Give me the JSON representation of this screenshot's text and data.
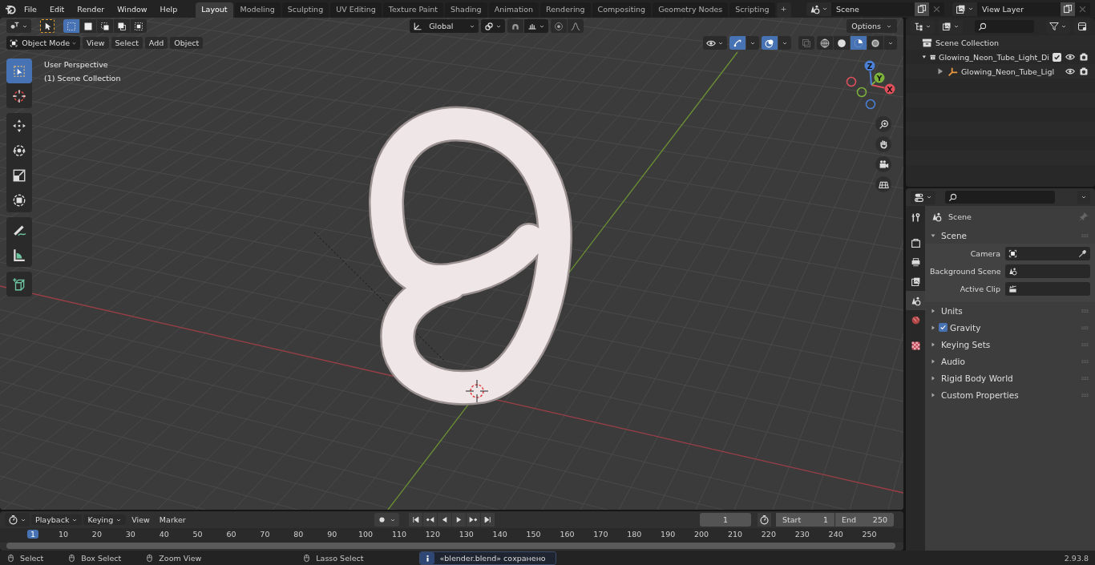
{
  "menu": [
    "File",
    "Edit",
    "Render",
    "Window",
    "Help"
  ],
  "workspaces": [
    {
      "label": "Layout",
      "selected": true
    },
    {
      "label": "Modeling",
      "selected": false
    },
    {
      "label": "Sculpting",
      "selected": false
    },
    {
      "label": "UV Editing",
      "selected": false
    },
    {
      "label": "Texture Paint",
      "selected": false
    },
    {
      "label": "Shading",
      "selected": false
    },
    {
      "label": "Animation",
      "selected": false
    },
    {
      "label": "Rendering",
      "selected": false
    },
    {
      "label": "Compositing",
      "selected": false
    },
    {
      "label": "Geometry Nodes",
      "selected": false
    },
    {
      "label": "Scripting",
      "selected": false
    }
  ],
  "add_workspace": "+",
  "scene_selector": {
    "value": "Scene"
  },
  "view_layer_selector": {
    "value": "View Layer"
  },
  "viewport": {
    "header": {
      "mode": "Object Mode",
      "menus": [
        "View",
        "Select",
        "Add",
        "Object"
      ],
      "orientation": "Global",
      "options": "Options",
      "select_modes": [
        {
          "selected": true
        },
        {
          "selected": false
        },
        {
          "selected": false
        },
        {
          "selected": false
        },
        {
          "selected": false
        }
      ],
      "snap": {
        "on": false
      },
      "proportional_editing": {
        "on": false
      },
      "gizmos": {
        "on": true
      },
      "overlays": {
        "on": true
      },
      "shading_modes": [
        {
          "selected": false
        },
        {
          "selected": false
        },
        {
          "selected": true
        },
        {
          "selected": false
        }
      ]
    },
    "info": [
      "User Perspective",
      "(1) Scene Collection"
    ],
    "tools": [
      {
        "kind": "select_box",
        "selected": true
      },
      {
        "kind": "cursor",
        "selected": false
      },
      {
        "kind": "move",
        "selected": false
      },
      {
        "kind": "rotate",
        "selected": false
      },
      {
        "kind": "scale",
        "selected": false
      },
      {
        "kind": "transform",
        "selected": false
      },
      {
        "kind": "annotate",
        "selected": false
      },
      {
        "kind": "measure",
        "selected": false
      },
      {
        "kind": "add_cube",
        "selected": false
      }
    ],
    "gizmo_axes": [
      {
        "label": "X"
      },
      {
        "label": "Y"
      },
      {
        "label": "Z"
      }
    ]
  },
  "outliner": {
    "root": "Scene Collection",
    "children": [
      {
        "label": "Glowing_Neon_Tube_Light_Di",
        "expanded": true,
        "checked": true,
        "children": [
          {
            "label": "Glowing_Neon_Tube_Ligl",
            "expanded": false
          }
        ]
      }
    ]
  },
  "properties": {
    "tabs": [
      {
        "kind": "tool",
        "selected": false
      },
      {
        "kind": "render",
        "selected": false
      },
      {
        "kind": "output",
        "selected": false
      },
      {
        "kind": "view_layer",
        "selected": false
      },
      {
        "kind": "scene",
        "selected": true
      },
      {
        "kind": "world",
        "selected": false
      },
      {
        "kind": "texture",
        "selected": false
      }
    ],
    "context": "Scene",
    "panel": {
      "title": "Scene",
      "expanded": true,
      "fields": [
        {
          "label": "Camera",
          "kind": "camera"
        },
        {
          "label": "Background Scene",
          "kind": "scene"
        },
        {
          "label": "Active Clip",
          "kind": "clip"
        }
      ]
    },
    "subpanels": [
      {
        "title": "Units",
        "expanded": false
      },
      {
        "title": "Gravity",
        "expanded": false,
        "checked": true
      },
      {
        "title": "Keying Sets",
        "expanded": false
      },
      {
        "title": "Audio",
        "expanded": false
      },
      {
        "title": "Rigid Body World",
        "expanded": false
      },
      {
        "title": "Custom Properties",
        "expanded": false
      }
    ]
  },
  "timeline": {
    "menus": [
      {
        "label": "Playback",
        "dropdown": true
      },
      {
        "label": "Keying",
        "dropdown": true
      },
      {
        "label": "View",
        "dropdown": false
      },
      {
        "label": "Marker",
        "dropdown": false
      }
    ],
    "auto_keying": {
      "on": false
    },
    "current_frame": "1",
    "start_label": "Start",
    "start": "1",
    "end_label": "End",
    "end": "250",
    "ruler": [
      {
        "label": "1",
        "selected": true
      },
      {
        "label": "10",
        "selected": false
      },
      {
        "label": "20",
        "selected": false
      },
      {
        "label": "30",
        "selected": false
      },
      {
        "label": "40",
        "selected": false
      },
      {
        "label": "50",
        "selected": false
      },
      {
        "label": "60",
        "selected": false
      },
      {
        "label": "70",
        "selected": false
      },
      {
        "label": "80",
        "selected": false
      },
      {
        "label": "90",
        "selected": false
      },
      {
        "label": "100",
        "selected": false
      },
      {
        "label": "110",
        "selected": false
      },
      {
        "label": "120",
        "selected": false
      },
      {
        "label": "130",
        "selected": false
      },
      {
        "label": "140",
        "selected": false
      },
      {
        "label": "150",
        "selected": false
      },
      {
        "label": "160",
        "selected": false
      },
      {
        "label": "170",
        "selected": false
      },
      {
        "label": "180",
        "selected": false
      },
      {
        "label": "190",
        "selected": false
      },
      {
        "label": "200",
        "selected": false
      },
      {
        "label": "210",
        "selected": false
      },
      {
        "label": "220",
        "selected": false
      },
      {
        "label": "230",
        "selected": false
      },
      {
        "label": "240",
        "selected": false
      },
      {
        "label": "250",
        "selected": false
      }
    ]
  },
  "status_bar": {
    "hints": [
      "Select",
      "Box Select",
      "Zoom View",
      "Lasso Select"
    ],
    "message": "«blender.blend» сохранено",
    "version": "2.93.8"
  }
}
